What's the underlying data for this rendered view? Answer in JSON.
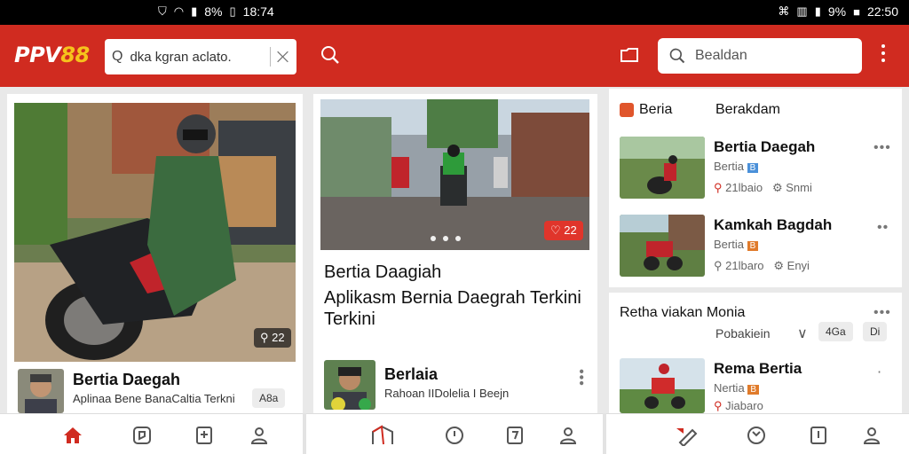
{
  "status_bar": {
    "center_icons": [
      "shield-icon",
      "wifi-icon",
      "signal-icon"
    ],
    "center_battery": "8%",
    "center_time": "18:74",
    "right_icons": [
      "nfc-icon",
      "vibrate-icon",
      "signal-icon"
    ],
    "right_battery": "9%",
    "right_time": "22:50"
  },
  "app_bar": {
    "logo_part1": "PPV",
    "logo_part2": "88",
    "search_left": {
      "prefix": "Q",
      "value": "dka kgran aclato."
    },
    "search_right": {
      "value": "Bealdan"
    }
  },
  "card1": {
    "view_count": "22",
    "title": "Bertia Daegah",
    "subtitle": "Aplinaa Bene BanaCaltia Terkni",
    "chip": "A8a"
  },
  "card2": {
    "badge": "22",
    "headline": "Bertia Daagiah",
    "description": "Aplikasm Bernia Daegrah Terkini Terkini",
    "author": {
      "name": "Berlaia",
      "desc": "Rahoan IIDolelia I Beejn"
    }
  },
  "list1": {
    "header_left": "Beria",
    "header_right": "Berakdam",
    "items": [
      {
        "title": "Bertia Daegah",
        "source": "Bertia",
        "meta1": "21lbaio",
        "meta2": "Snmi"
      },
      {
        "title": "Kamkah Bagdah",
        "source": "Bertia",
        "meta1": "21lbaro",
        "meta2": "Enyi"
      }
    ]
  },
  "list2": {
    "header": "Retha viakan Monia",
    "filter_label": "Pobakiein",
    "chip1": "4Ga",
    "chip2": "Di",
    "item": {
      "title": "Rema Bertia",
      "source": "Nertia",
      "meta1": "Jiabaro"
    }
  },
  "bottom_nav": {
    "active_color": "#d02b20",
    "icons": [
      "home-icon",
      "tag-icon",
      "bookmark-icon",
      "profile-icon",
      "news-icon",
      "clock-icon",
      "document-icon",
      "profile-icon",
      "pen-icon",
      "clock-icon",
      "book-icon",
      "profile-icon"
    ]
  }
}
